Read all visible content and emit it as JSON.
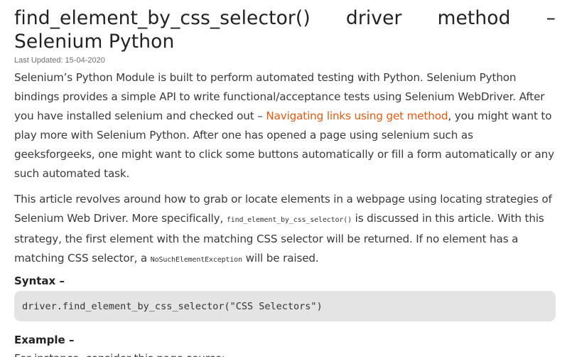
{
  "article": {
    "title": "find_element_by_css_selector() driver method – Selenium Python",
    "last_updated": "Last Updated: 15-04-2020",
    "p1": {
      "before_link": "Selenium’s Python Module is built to perform automated testing with Python. Selenium Python bindings provides a simple API to write functional/acceptance tests using Selenium WebDriver. After you have installed selenium and checked out – ",
      "link_text": "Navigating links using get method",
      "after_link": ", you might want to play more with Selenium Python. After one has opened a page using selenium such as geeksforgeeks, one might want to click some buttons automatically or fill a form automatically or any such automated task."
    },
    "p2": {
      "part1": "This article revolves around how to grab or locate elements in a webpage using locating strategies of Selenium Web Driver. More specifically, ",
      "code1": "find_element_by_css_selector()",
      "part2": " is discussed in this article. With this strategy, the first element with the matching CSS selector will be returned. If no element has a matching CSS selector, a ",
      "code2": "NoSuchElementException",
      "part3": " will be raised."
    },
    "syntax_heading": "Syntax –",
    "syntax_code": "driver.find_element_by_css_selector(\"CSS Selectors\")",
    "example_heading": "Example –",
    "example_text": "For instance, consider this page source:"
  },
  "colors": {
    "link": "#e8590c",
    "code_background": "#e4e4e4",
    "text": "#3a3a3a"
  }
}
